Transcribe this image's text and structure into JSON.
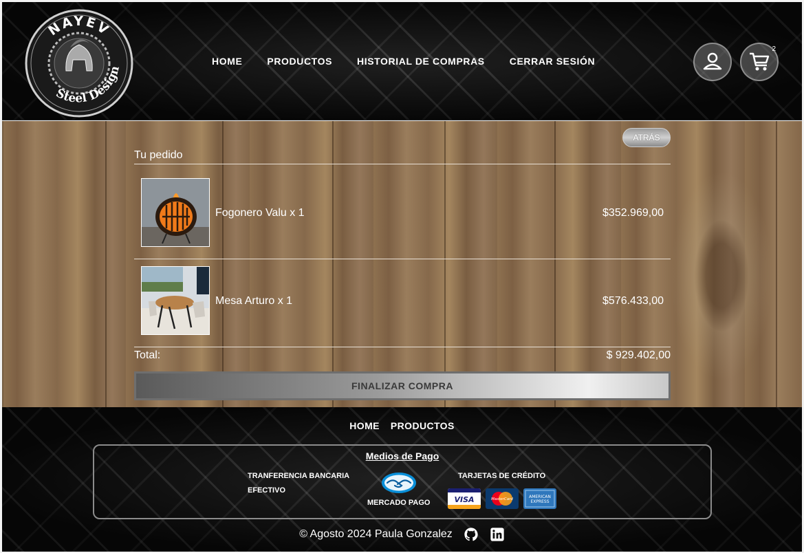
{
  "brand": {
    "logo_top": "NAYEV",
    "logo_bottom": "Steel Design"
  },
  "nav": {
    "items": [
      "HOME",
      "PRODUCTOS",
      "HISTORIAL DE COMPRAS",
      "CERRAR SESIÓN"
    ]
  },
  "header_icons": {
    "user": "user-icon",
    "cart": "cart-icon",
    "cart_count": "2"
  },
  "order": {
    "back_label": "ATRÁS",
    "title": "Tu pedido",
    "items": [
      {
        "name": "Fogonero Valu x 1",
        "price": "$352.969,00"
      },
      {
        "name": "Mesa Arturo x 1",
        "price": "$576.433,00"
      }
    ],
    "total_label": "Total:",
    "total_value": "$ 929.402,00",
    "checkout_label": "FINALIZAR COMPRA"
  },
  "footer": {
    "nav": [
      "HOME",
      "PRODUCTOS"
    ],
    "payment_title": "Medios de Pago",
    "transfer": "TRANFERENCIA BANCARIA",
    "cash": "EFECTIVO",
    "mercado_pago": "MERCADO PAGO",
    "credit_cards": "TARJETAS DE CRÉDITO",
    "card_visa": "VISA",
    "card_mastercard": "MasterCard",
    "card_amex_top": "AMERICAN",
    "card_amex_bottom": "EXPRESS",
    "credits": "© Agosto 2024 Paula Gonzalez"
  },
  "colors": {
    "wood": "#8a6d4e",
    "metal": "#0d0d0d",
    "text": "#ffffff"
  }
}
